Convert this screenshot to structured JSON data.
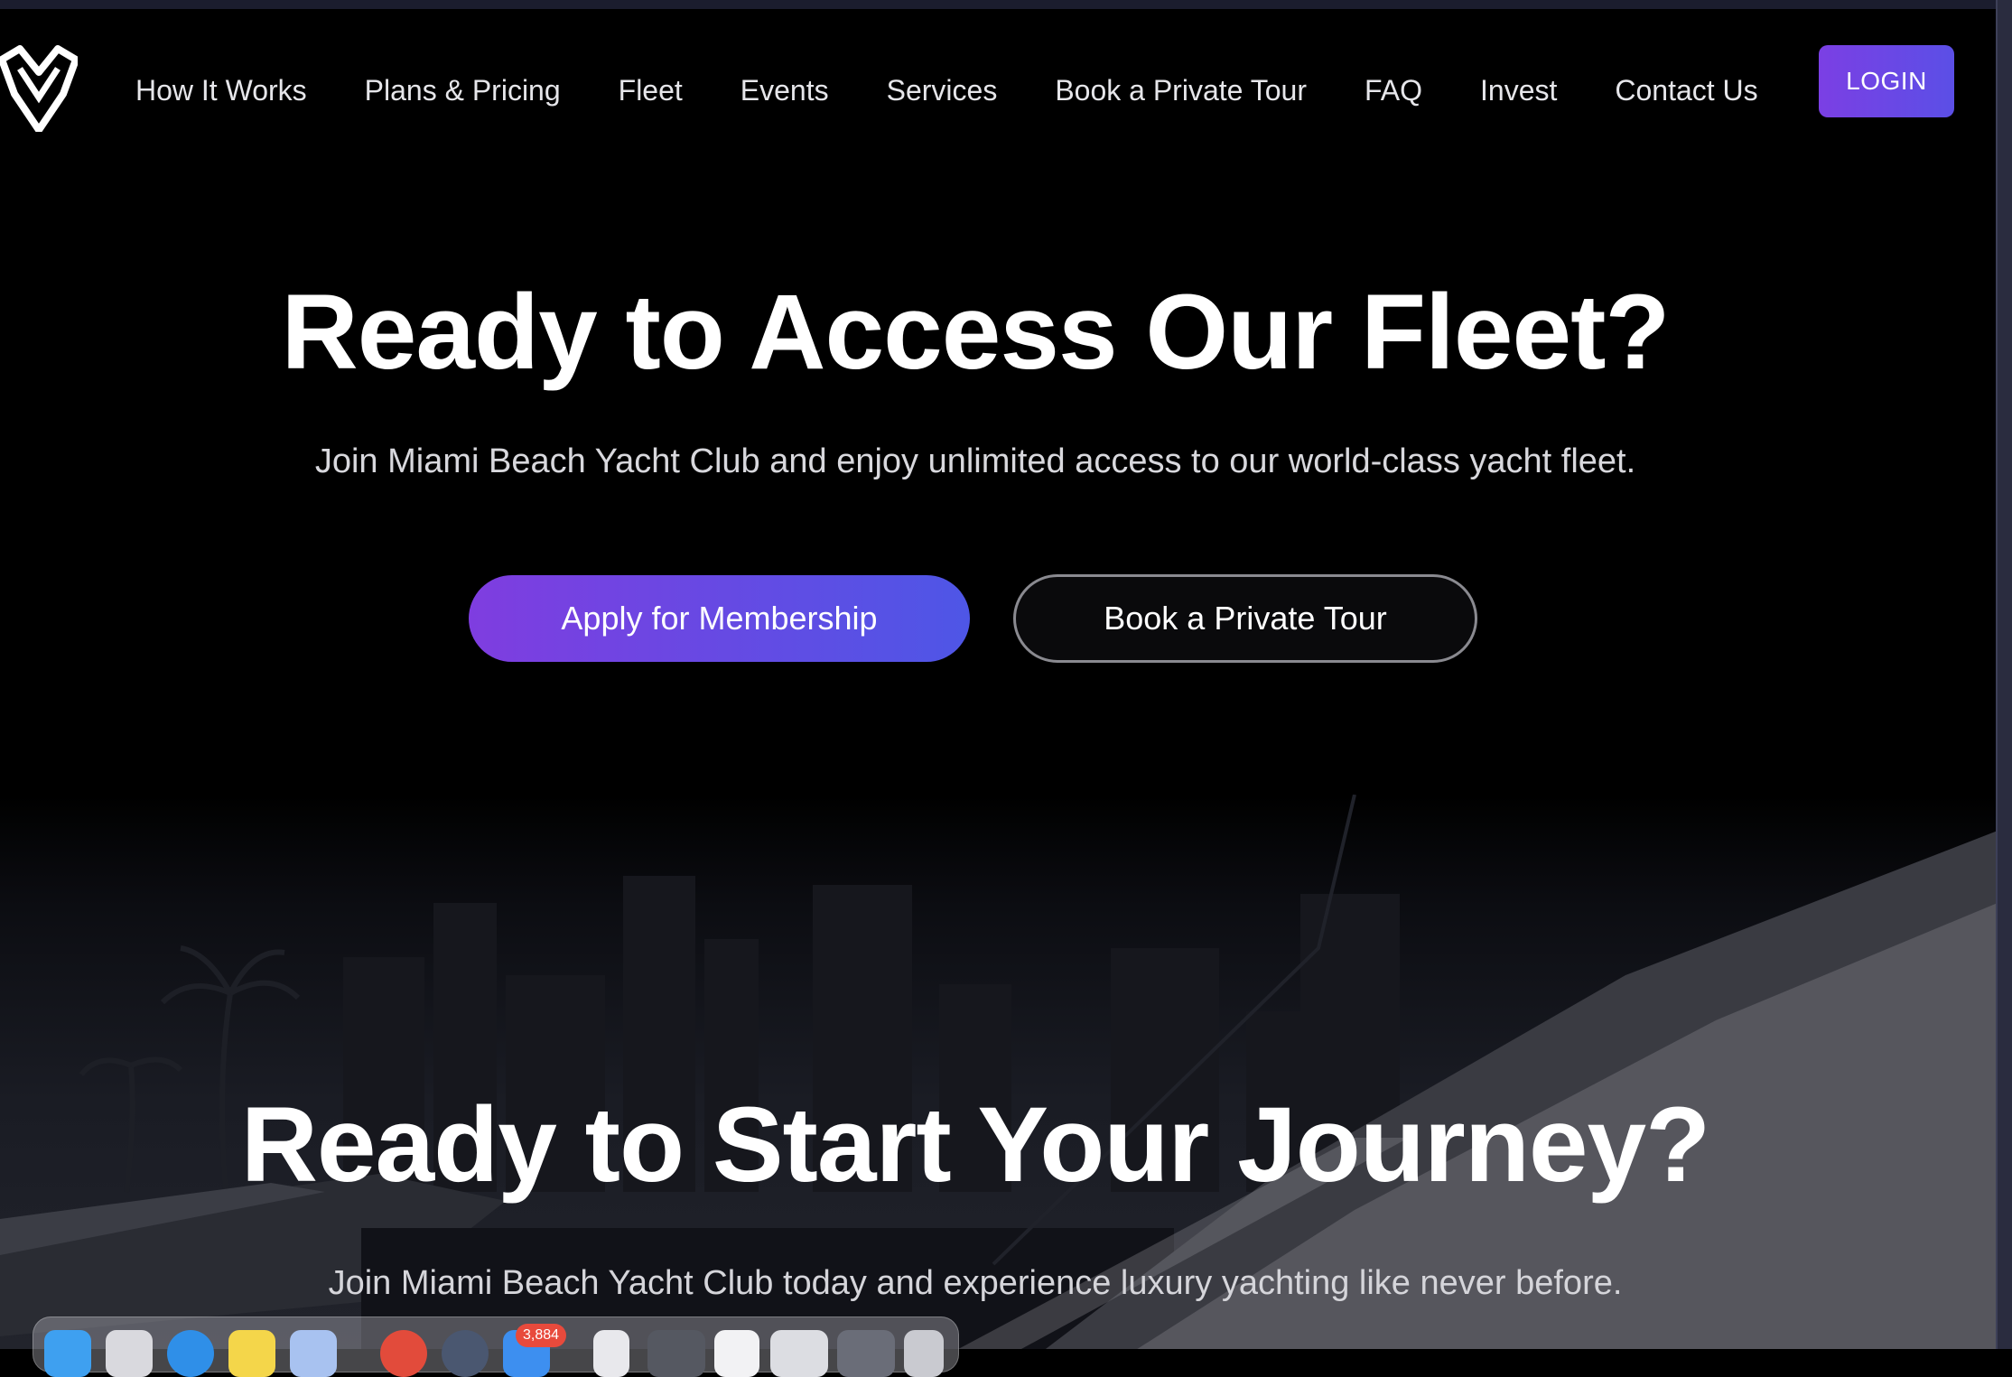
{
  "nav": {
    "links": [
      {
        "label": "How It Works"
      },
      {
        "label": "Plans & Pricing"
      },
      {
        "label": "Fleet"
      },
      {
        "label": "Events"
      },
      {
        "label": "Services"
      },
      {
        "label": "Book a Private Tour"
      },
      {
        "label": "FAQ"
      },
      {
        "label": "Invest"
      },
      {
        "label": "Contact Us"
      }
    ],
    "login_label": "LOGIN"
  },
  "hero1": {
    "title": "Ready to Access Our Fleet?",
    "subtitle": "Join Miami Beach Yacht Club and enjoy unlimited access to our world-class yacht fleet.",
    "apply_label": "Apply for Membership",
    "tour_label": "Book a Private Tour"
  },
  "hero2": {
    "title": "Ready to Start Your Journey?",
    "subtitle": "Join Miami Beach Yacht Club today and experience luxury yachting like never before."
  },
  "dock": {
    "mail_badge": "3,884",
    "icons": [
      "finder-icon",
      "launchpad-icon",
      "safari-icon",
      "notes-icon",
      "preview-icon",
      "chrome-icon",
      "quicktime-icon",
      "mail-icon",
      "document-icon",
      "window-thumb-icon",
      "sheet-icon",
      "window-thumb-icon",
      "window-thumb-icon",
      "trash-icon"
    ]
  },
  "colors": {
    "accent_start": "#7b3fe4",
    "accent_end": "#4e56e6",
    "background": "#000000"
  }
}
